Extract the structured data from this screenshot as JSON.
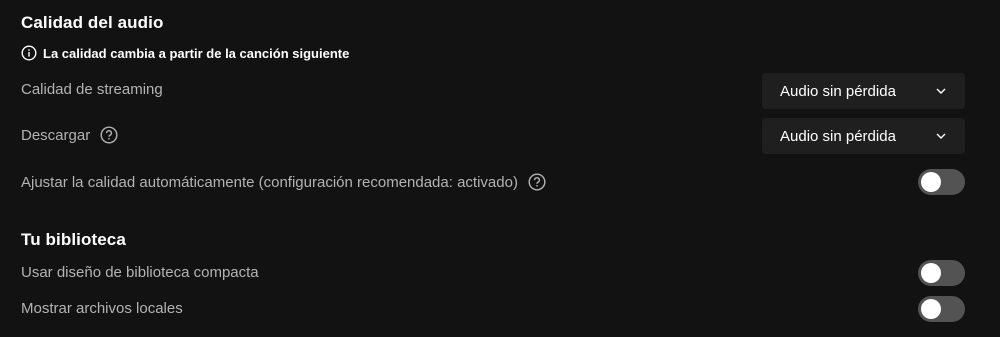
{
  "audio_quality": {
    "title": "Calidad del audio",
    "notice": "La calidad cambia a partir de la canción siguiente",
    "streaming": {
      "label": "Calidad de streaming",
      "selected": "Audio sin pérdida"
    },
    "download": {
      "label": "Descargar",
      "selected": "Audio sin pérdida"
    },
    "auto_adjust": {
      "label": "Ajustar la calidad automáticamente (configuración recomendada: activado)",
      "enabled": false
    }
  },
  "library": {
    "title": "Tu biblioteca",
    "compact_layout": {
      "label": "Usar diseño de biblioteca compacta",
      "enabled": false
    },
    "local_files": {
      "label": "Mostrar archivos locales",
      "enabled": false
    }
  },
  "colors": {
    "background": "#121212",
    "label_text": "#b3b3b3",
    "dropdown_bg": "#1f1f1f",
    "toggle_off": "#535353"
  }
}
